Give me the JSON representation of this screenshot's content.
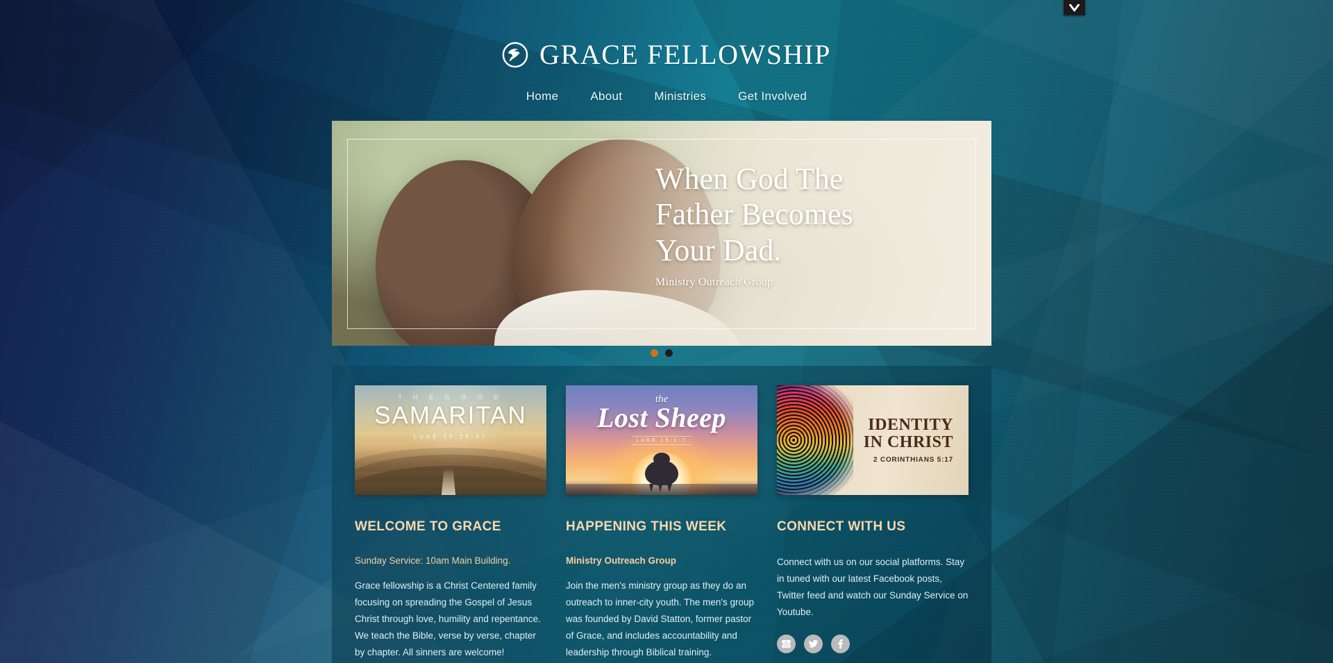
{
  "window": {
    "top_chip_icon": "chevron-down-icon"
  },
  "header": {
    "logo_icon": "dove-in-circle-logo-icon",
    "brand_name": "GRACE FELLOWSHIP",
    "nav": [
      {
        "label": "Home"
      },
      {
        "label": "About"
      },
      {
        "label": "Ministries"
      },
      {
        "label": "Get Involved"
      }
    ]
  },
  "hero": {
    "title_line1": "When God The",
    "title_line2": "Father Becomes",
    "title_line3": "Your Dad.",
    "subtitle": "Ministry Outreach Group",
    "image_alt": "Father and son smiling together outdoors",
    "dots": [
      {
        "active": true,
        "color": "#d4711a"
      },
      {
        "active": false,
        "color": "#1d1d1d"
      }
    ]
  },
  "cards": [
    {
      "name": "card-good-samaritan",
      "eyebrow": "T H E   G O O D",
      "title": "SAMARITAN",
      "reference": "LUKE 10:25-37"
    },
    {
      "name": "card-lost-sheep",
      "eyebrow": "the",
      "title": "Lost Sheep",
      "reference": "LUKE 15:1-7"
    },
    {
      "name": "card-identity-in-christ",
      "eyebrow": "",
      "title_line1": "IDENTITY",
      "title_line2": "IN CHRIST",
      "reference": "2 CORINTHIANS 5:17"
    }
  ],
  "columns": [
    {
      "name": "welcome",
      "heading": "WELCOME TO GRACE",
      "subheading": "Sunday Service:  10am Main Building.",
      "body": "Grace fellowship is a Christ Centered family focusing on spreading the Gospel of Jesus Christ through love, humility and repentance.  We teach the Bible, verse by verse, chapter by chapter. All sinners are welcome!"
    },
    {
      "name": "happening",
      "heading": "HAPPENING THIS WEEK",
      "subheading": "Ministry Outreach Group",
      "body": "Join the men's ministry group as they do an outreach to inner-city youth. The men's group was founded by David Statton, former pastor of Grace, and includes accountability and leadership through Biblical training."
    },
    {
      "name": "connect",
      "heading": "CONNECT WITH US",
      "subheading": "",
      "body": "Connect with us on our social platforms. Stay in tuned with our latest Facebook posts, Twitter feed and watch our Sunday Service on Youtube."
    }
  ],
  "social": [
    {
      "name": "youtube-icon",
      "label": "YouTube"
    },
    {
      "name": "twitter-icon",
      "label": "Twitter"
    },
    {
      "name": "facebook-icon",
      "label": "Facebook"
    }
  ],
  "theme": {
    "accent_heading": "#f9d8ad",
    "accent_sub": "#f6cf9f",
    "body_text": "#dff0f4",
    "bg_navy": "#0a1a4e",
    "bg_teal": "#157d93",
    "dot_active": "#d4711a"
  }
}
